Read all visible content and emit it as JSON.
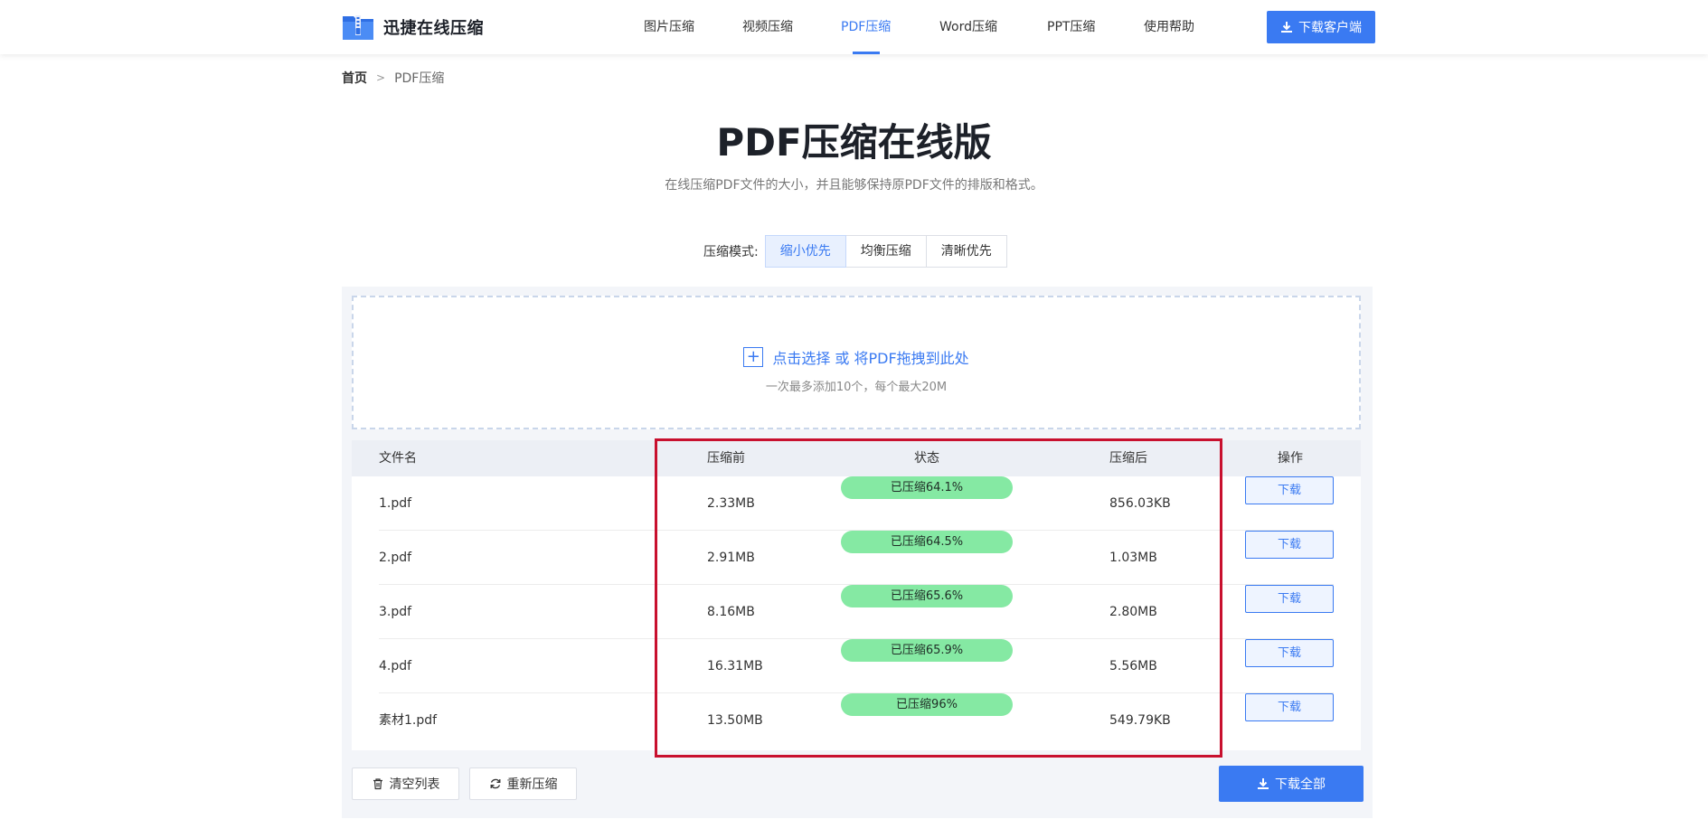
{
  "header": {
    "logo_text": "迅捷在线压缩",
    "nav": [
      "图片压缩",
      "视频压缩",
      "PDF压缩",
      "Word压缩",
      "PPT压缩",
      "使用帮助"
    ],
    "active_nav": "PDF压缩",
    "download_client": "下载客户端"
  },
  "breadcrumb": {
    "home": "首页",
    "separator": ">",
    "current": "PDF压缩"
  },
  "hero": {
    "title": "PDF压缩在线版",
    "subtitle": "在线压缩PDF文件的大小，并且能够保持原PDF文件的排版和格式。"
  },
  "mode": {
    "label": "压缩模式:",
    "options": [
      "缩小优先",
      "均衡压缩",
      "清晰优先"
    ],
    "selected": "缩小优先"
  },
  "dropzone": {
    "main": "点击选择 或 将PDF拖拽到此处",
    "sub": "一次最多添加10个，每个最大20M"
  },
  "table": {
    "headers": {
      "name": "文件名",
      "before": "压缩前",
      "status": "状态",
      "after": "压缩后",
      "action": "操作"
    },
    "rows": [
      {
        "name": "1.pdf",
        "before": "2.33MB",
        "status": "已压缩64.1%",
        "after": "856.03KB",
        "action": "下载"
      },
      {
        "name": "2.pdf",
        "before": "2.91MB",
        "status": "已压缩64.5%",
        "after": "1.03MB",
        "action": "下载"
      },
      {
        "name": "3.pdf",
        "before": "8.16MB",
        "status": "已压缩65.6%",
        "after": "2.80MB",
        "action": "下载"
      },
      {
        "name": "4.pdf",
        "before": "16.31MB",
        "status": "已压缩65.9%",
        "after": "5.56MB",
        "action": "下载"
      },
      {
        "name": "素材1.pdf",
        "before": "13.50MB",
        "status": "已压缩96%",
        "after": "549.79KB",
        "action": "下载"
      }
    ]
  },
  "actions": {
    "clear": "清空列表",
    "recompress": "重新压缩",
    "download_all": "下载全部"
  },
  "colors": {
    "accent": "#3a7af2",
    "status_pill": "#85e9a3",
    "highlight_box": "#c8102e"
  }
}
